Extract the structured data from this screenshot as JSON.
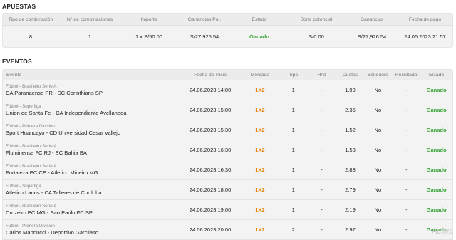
{
  "apuestas": {
    "title": "APUESTAS",
    "headers": [
      "Tipo de combinación",
      "N° de combinaciones",
      "Importe",
      "Ganancias Pot.",
      "Estado",
      "Bono potencial",
      "Ganancias",
      "Fecha de pago"
    ],
    "row": {
      "tipo": "8",
      "numero": "1",
      "importe": "1 x S/50.00",
      "ganancias_pot": "S/27,926.54",
      "estado": "Ganado",
      "bono": "S/0.00",
      "ganancias": "S/27,926.54",
      "fecha_pago": "24.06.2023 21:57"
    }
  },
  "eventos": {
    "title": "EVENTOS",
    "headers": {
      "evento": "Evento",
      "fecha": "Fecha de inicio",
      "mercado": "Mercado",
      "tipo": "Tipo",
      "hnd": "Hnd",
      "cuotas": "Cuotas",
      "banquero": "Banquero",
      "resultado": "Resultado",
      "estado": "Estado"
    },
    "rows": [
      {
        "comp": "Fútbol - Brasileiro Serie A",
        "match": "CA Paranaense PR - SC Corinthians SP",
        "fecha": "24.06.2023 14:00",
        "mercado": "1X2",
        "tipo": "1",
        "hnd": "-",
        "cuota": "1.99",
        "banquero": "No",
        "resultado": "-",
        "estado": "Ganado"
      },
      {
        "comp": "Fútbol - Superliga",
        "match": "Union de Santa Fe - CA Independiente Avellaneda",
        "fecha": "24.06.2023 15:00",
        "mercado": "1X2",
        "tipo": "1",
        "hnd": "-",
        "cuota": "2.35",
        "banquero": "No",
        "resultado": "-",
        "estado": "Ganado"
      },
      {
        "comp": "Fútbol - Primera Division",
        "match": "Sport Huancayo - CD Universidad Cesar Vallejo",
        "fecha": "24.06.2023 15:30",
        "mercado": "1X2",
        "tipo": "1",
        "hnd": "-",
        "cuota": "1.52",
        "banquero": "No",
        "resultado": "-",
        "estado": "Ganado"
      },
      {
        "comp": "Fútbol - Brasileiro Serie A",
        "match": "Fluminense FC RJ - EC Bahia BA",
        "fecha": "24.06.2023 16:30",
        "mercado": "1X2",
        "tipo": "1",
        "hnd": "-",
        "cuota": "1.53",
        "banquero": "No",
        "resultado": "-",
        "estado": "Ganado"
      },
      {
        "comp": "Fútbol - Brasileiro Serie A",
        "match": "Fortaleza EC CE - Atletico Mineiro MG",
        "fecha": "24.06.2023 16:30",
        "mercado": "1X2",
        "tipo": "1",
        "hnd": "-",
        "cuota": "2.83",
        "banquero": "No",
        "resultado": "-",
        "estado": "Ganado"
      },
      {
        "comp": "Fútbol - Superliga",
        "match": "Atletico Lanus - CA Talleres de Cordoba",
        "fecha": "24.06.2023 18:00",
        "mercado": "1X2",
        "tipo": "1",
        "hnd": "-",
        "cuota": "2.79",
        "banquero": "No",
        "resultado": "-",
        "estado": "Ganado"
      },
      {
        "comp": "Fútbol - Brasileiro Serie A",
        "match": "Cruzeiro EC MG - Sao Paulo FC SP",
        "fecha": "24.06.2023 19:00",
        "mercado": "1X2",
        "tipo": "1",
        "hnd": "-",
        "cuota": "2.19",
        "banquero": "No",
        "resultado": "-",
        "estado": "Ganado"
      },
      {
        "comp": "Fútbol - Primera Division",
        "match": "Carlos Mannucci - Deportivo Garcilaso",
        "fecha": "24.06.2023 20:00",
        "mercado": "1X2",
        "tipo": "2",
        "hnd": "-",
        "cuota": "2.97",
        "banquero": "No",
        "resultado": "-",
        "estado": "Ganado"
      }
    ]
  },
  "watermark": "Activa",
  "colors": {
    "win": "#3aa53a",
    "market": "#e8860c",
    "header_bg": "#ececec",
    "box_bg": "#f3f3f3"
  }
}
